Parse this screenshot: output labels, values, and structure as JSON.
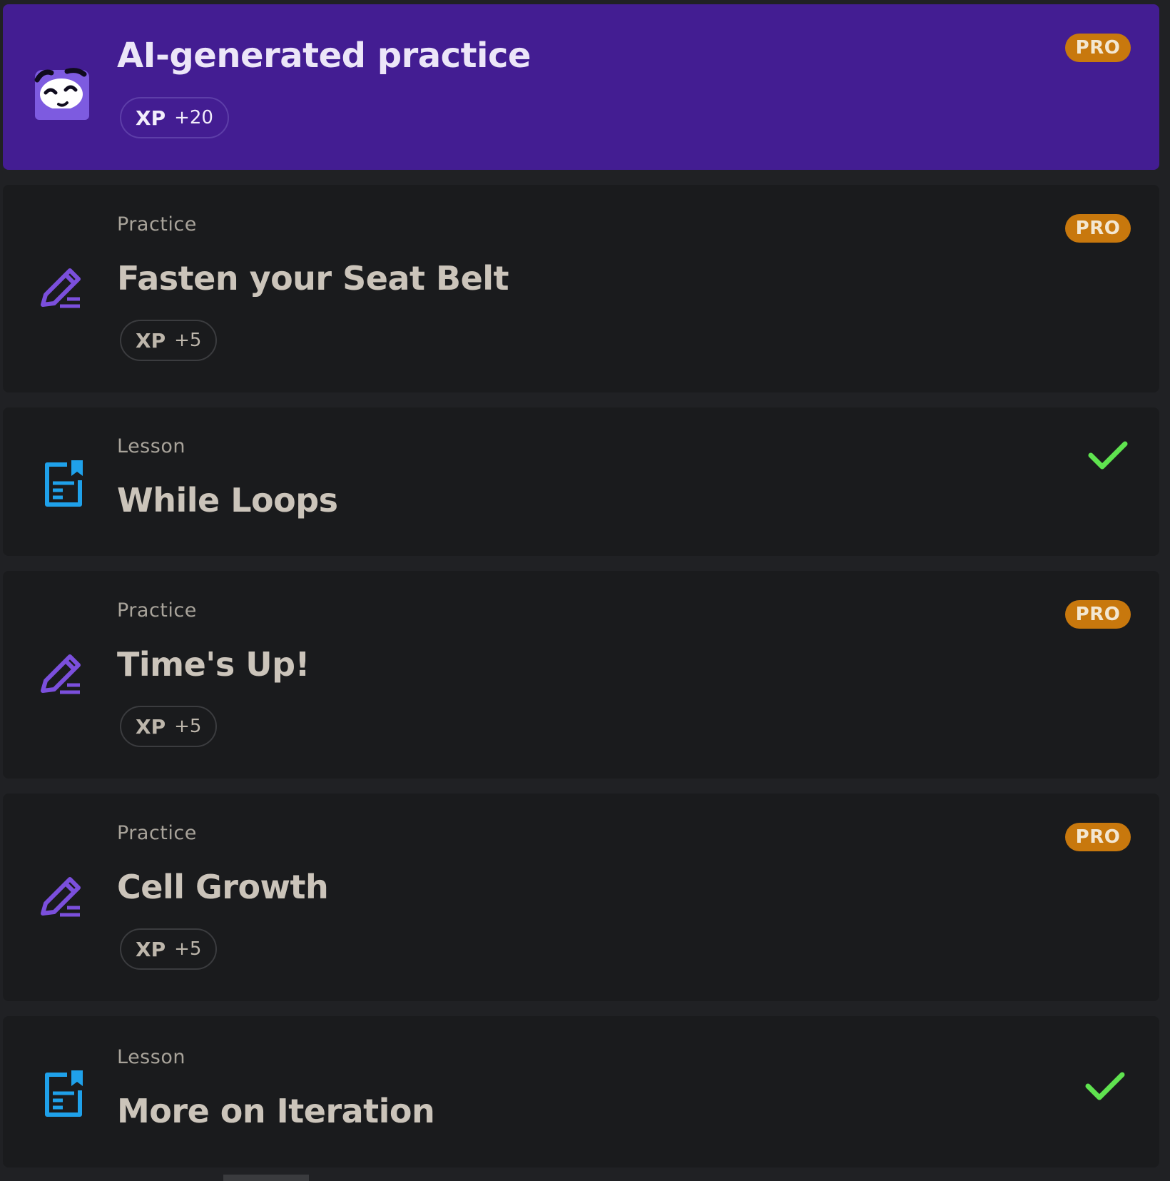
{
  "colors": {
    "background": "#202124",
    "card": "#1a1b1d",
    "featured": "#431d92",
    "pro_badge": "#c8780d",
    "practice_icon": "#7b4fdc",
    "lesson_icon": "#1fa1ea",
    "check": "#5fe34f"
  },
  "featured": {
    "title": "AI-generated practice",
    "xp_label": "XP",
    "xp_value": "+20",
    "pro": "PRO",
    "icon": "ai-mascot-icon"
  },
  "items": [
    {
      "type": "Practice",
      "title": "Fasten your Seat Belt",
      "xp_label": "XP",
      "xp_value": "+5",
      "pro": "PRO",
      "icon": "pencil-icon"
    },
    {
      "type": "Lesson",
      "title": "While Loops",
      "completed": true,
      "icon": "document-icon"
    },
    {
      "type": "Practice",
      "title": "Time's Up!",
      "xp_label": "XP",
      "xp_value": "+5",
      "pro": "PRO",
      "icon": "pencil-icon"
    },
    {
      "type": "Practice",
      "title": "Cell Growth",
      "xp_label": "XP",
      "xp_value": "+5",
      "pro": "PRO",
      "icon": "pencil-icon"
    },
    {
      "type": "Lesson",
      "title": "More on Iteration",
      "completed": true,
      "icon": "document-icon"
    }
  ]
}
